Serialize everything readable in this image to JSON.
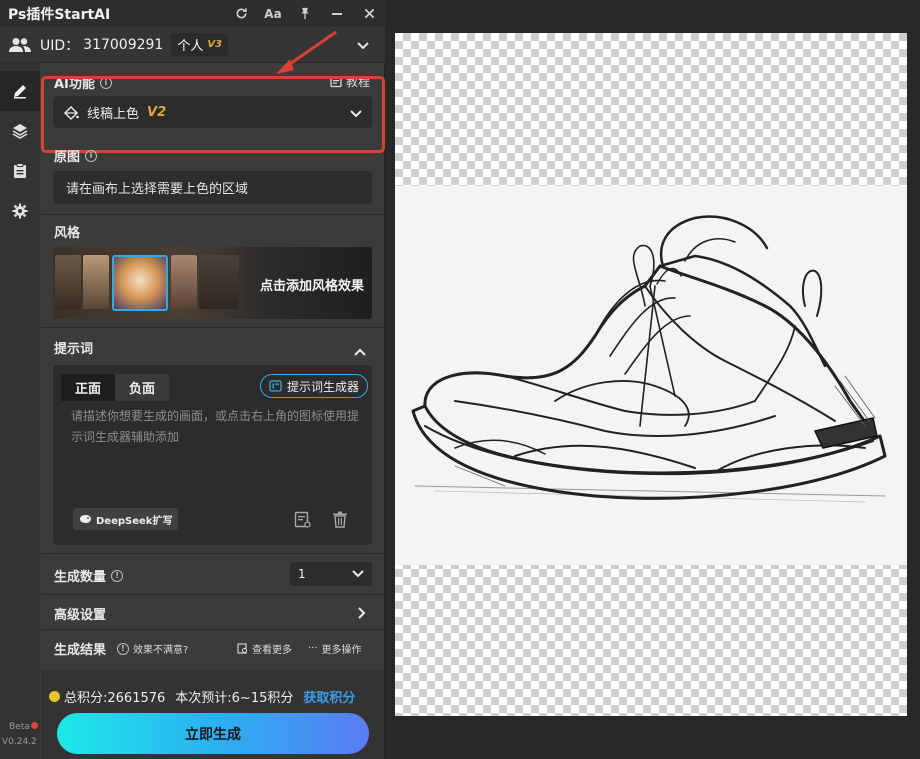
{
  "titlebar": {
    "title": "Ps插件StartAI",
    "font_btn": "Aa"
  },
  "user": {
    "uid_label": "UID：",
    "uid_value": "317009291",
    "plan": "个人",
    "plan_version": "V3"
  },
  "ai_function": {
    "label": "AI功能",
    "tutorial": "教程",
    "selected": "线稿上色",
    "version": "V2"
  },
  "area": {
    "label": "原图",
    "value": "请在画布上选择需要上色的区域"
  },
  "style": {
    "label": "风格",
    "add_text": "点击添加风格效果"
  },
  "prompt": {
    "label": "提示词",
    "tab_positive": "正面",
    "tab_negative": "负面",
    "generator": "提示词生成器",
    "placeholder": "请描述你想要生成的画面，或点击右上角的图标使用提示词生成器辅助添加",
    "deepseek": "DeepSeek扩写"
  },
  "quantity": {
    "label": "生成数量",
    "value": "1"
  },
  "advanced": {
    "label": "高级设置"
  },
  "results": {
    "label": "生成结果",
    "unsatisfied": "效果不满意?",
    "view_more": "查看更多",
    "more_ops": "更多操作"
  },
  "footer": {
    "total_points": "总积分:2661576",
    "estimate": "本次预计:6~15积分",
    "get_points": "获取积分",
    "generate": "立即生成"
  },
  "version": {
    "beta": "Beta",
    "number": "V0.24.2"
  },
  "colors": {
    "accent_blue": "#35a9e6",
    "highlight_red": "#d54335",
    "gold": "#d8a93c"
  }
}
